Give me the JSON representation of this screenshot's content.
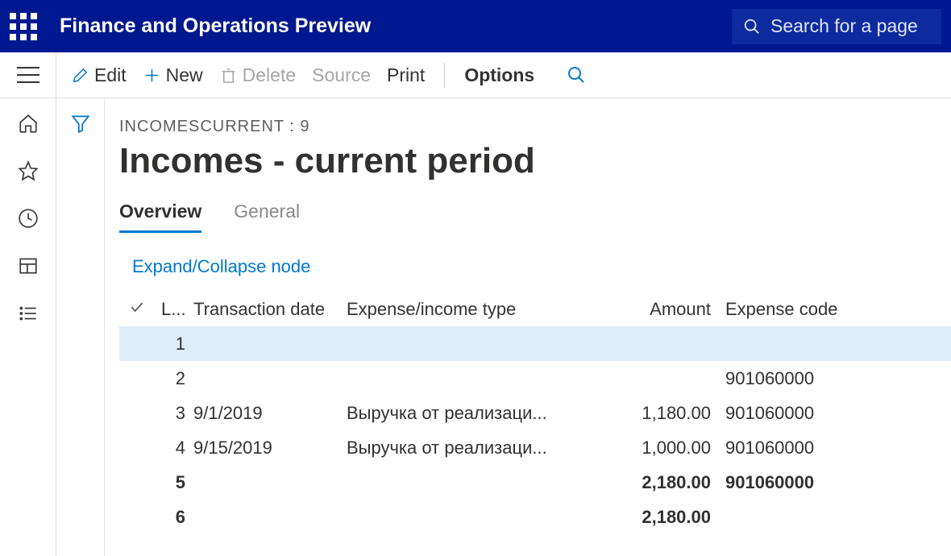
{
  "header": {
    "app_title": "Finance and Operations Preview",
    "search_placeholder": "Search for a page"
  },
  "toolbar": {
    "edit": "Edit",
    "new": "New",
    "delete": "Delete",
    "source": "Source",
    "print": "Print",
    "options": "Options"
  },
  "breadcrumb": "INCOMESCURRENT : 9",
  "page_title": "Incomes - current period",
  "tabs": {
    "overview": "Overview",
    "general": "General"
  },
  "links": {
    "expand": "Expand/Collapse node"
  },
  "grid": {
    "columns": {
      "line": "L...",
      "date": "Transaction date",
      "type": "Expense/income type",
      "amount": "Amount",
      "code": "Expense code"
    },
    "rows": [
      {
        "line": "1",
        "date": "",
        "type": "",
        "amount": "",
        "code": "",
        "highlight": true,
        "bold": false
      },
      {
        "line": "2",
        "date": "",
        "type": "",
        "amount": "",
        "code": "901060000",
        "highlight": false,
        "bold": false
      },
      {
        "line": "3",
        "date": "9/1/2019",
        "type": "Выручка от реализаци...",
        "amount": "1,180.00",
        "code": "901060000",
        "highlight": false,
        "bold": false
      },
      {
        "line": "4",
        "date": "9/15/2019",
        "type": "Выручка от реализаци...",
        "amount": "1,000.00",
        "code": "901060000",
        "highlight": false,
        "bold": false
      },
      {
        "line": "5",
        "date": "",
        "type": "",
        "amount": "2,180.00",
        "code": "901060000",
        "highlight": false,
        "bold": true
      },
      {
        "line": "6",
        "date": "",
        "type": "",
        "amount": "2,180.00",
        "code": "",
        "highlight": false,
        "bold": true
      }
    ]
  }
}
